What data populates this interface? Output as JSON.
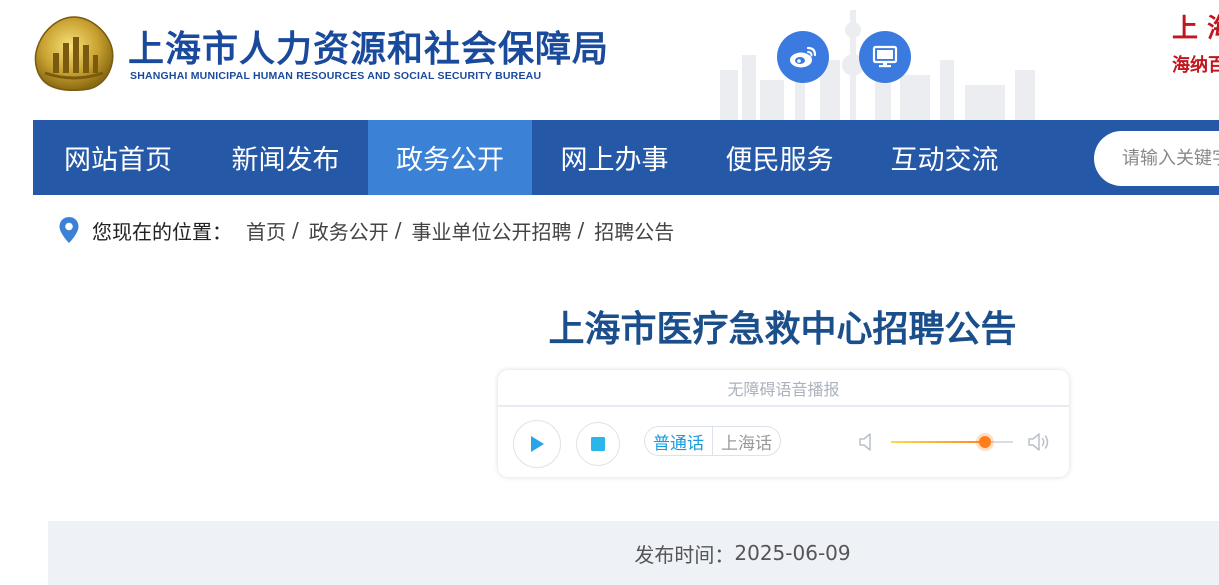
{
  "header": {
    "title": "上海市人力资源和社会保障局",
    "subtitle": "SHANGHAI MUNICIPAL HUMAN RESOURCES AND SOCIAL SECURITY BUREAU",
    "banner_line1": "上 海",
    "banner_line2": "海纳百",
    "icons": {
      "logo": "emblem-logo-icon",
      "weibo": "weibo-icon",
      "pc": "monitor-icon"
    }
  },
  "nav": {
    "items": [
      {
        "label": "网站首页"
      },
      {
        "label": "新闻发布"
      },
      {
        "label": "政务公开"
      },
      {
        "label": "网上办事"
      },
      {
        "label": "便民服务"
      },
      {
        "label": "互动交流"
      }
    ],
    "active_index": 2,
    "search_placeholder": "请输入关键字"
  },
  "breadcrumb": {
    "label": "您现在的位置：",
    "items": [
      "首页",
      "政务公开",
      "事业单位公开招聘",
      "招聘公告"
    ],
    "separator": "/"
  },
  "article": {
    "title": "上海市医疗急救中心招聘公告"
  },
  "player": {
    "header": "无障碍语音播报",
    "languages": [
      "普通话",
      "上海话"
    ],
    "selected_language": "普通话",
    "volume": 0.77,
    "icons": {
      "play": "play-icon",
      "stop": "stop-icon",
      "vol_low": "volume-low-icon",
      "vol_high": "volume-high-icon"
    }
  },
  "meta": {
    "publish_label": "发布时间：",
    "publish_date": "2025-06-09"
  },
  "colors": {
    "nav_bg": "#2559a8",
    "nav_active": "#3b82d6",
    "title": "#1a4f8c",
    "brand_blue": "#1a4a9c",
    "banner_red": "#c2161e",
    "accent": "#1a9be0",
    "volume_knob": "#ff7d1a"
  }
}
